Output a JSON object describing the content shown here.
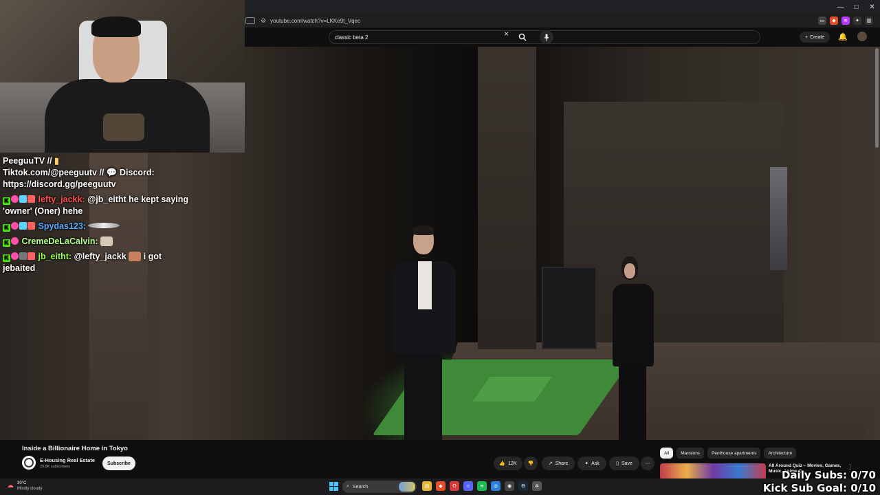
{
  "browser": {
    "url": "youtube.com/watch?v=LKKe9t_Vqec",
    "window_controls": [
      "—",
      "□",
      "✕"
    ]
  },
  "youtube": {
    "search_query": "classic beta 2",
    "create_label": "Create"
  },
  "chat": {
    "banner": {
      "line1": "PeeguuTV // ",
      "line2a": "Tiktok.com/@peeguutv // ",
      "line2b": " Discord:",
      "line3": "https://discord.gg/peeguutv"
    },
    "messages": [
      {
        "user": "lefty_jackk:",
        "text": " @jb_eitht he kept saying 'owner' (Oner) hehe"
      },
      {
        "user": "Spydas123:",
        "text": ""
      },
      {
        "user": "CremeDeLaCalvin:",
        "text": ""
      },
      {
        "user": "jb_eitht:",
        "text_a": " @lefty_jackk ",
        "text_b": " i got jebaited"
      }
    ]
  },
  "video": {
    "title": "Inside a Billionaire Home in Tokyo",
    "channel": "E-Housing Real Estate",
    "subscribers": "29.8K subscribers",
    "subscribe_label": "Subscribe",
    "like_count": "12K",
    "share_label": "Share",
    "ask_label": "Ask",
    "save_label": "Save"
  },
  "chips": [
    "All",
    "Mansions",
    "Penthouse apartments",
    "Architecture"
  ],
  "recommended": {
    "title": "All Around Quiz – Movies, Games, Music, Anime Q..."
  },
  "taskbar": {
    "temperature": "30°C",
    "weather": "Mostly cloudy",
    "search_label": "Search"
  },
  "goals": {
    "daily_subs": "Daily Subs: 0/70",
    "kick_sub_goal": "Kick Sub Goal: 0/10"
  },
  "colors": {
    "youtube_bg": "#0f0f0f",
    "kick_green": "#53fc18",
    "chat_user_red": "#ff4f4f",
    "chat_user_blue": "#5aa9ff",
    "chat_user_green": "#9aff52"
  }
}
